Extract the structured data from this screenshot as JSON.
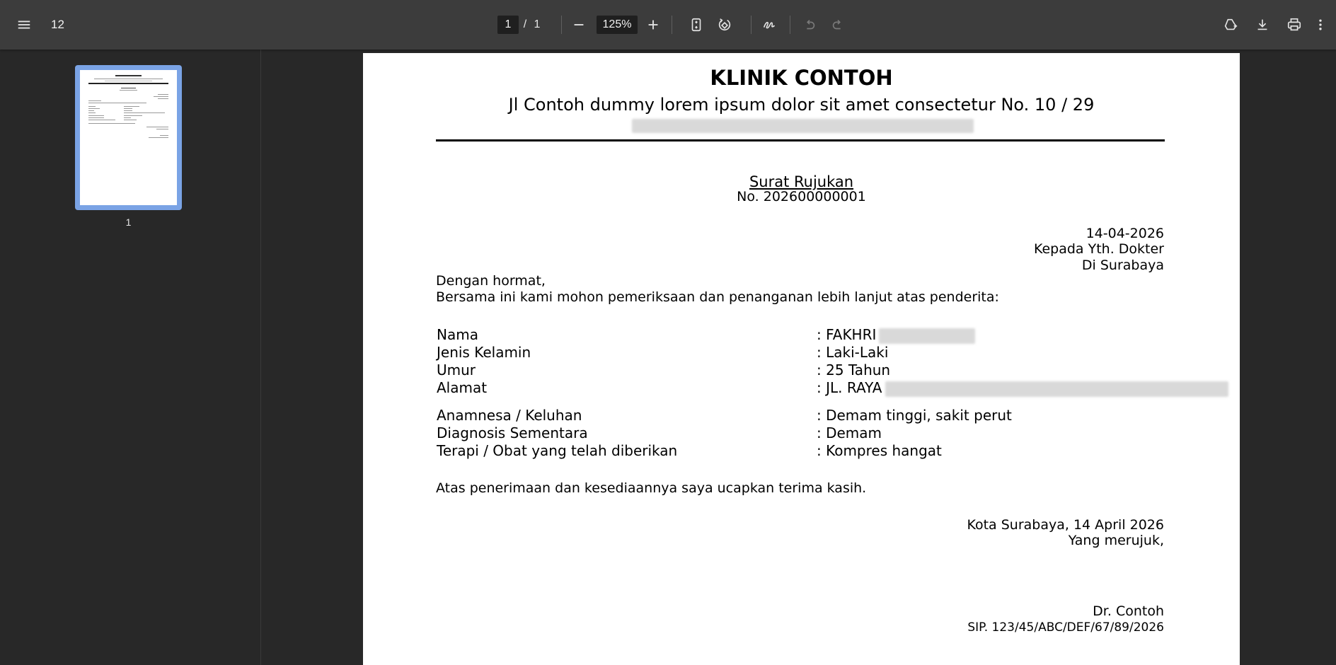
{
  "toolbar": {
    "doc_title": "12",
    "page_current": "1",
    "page_sep": "/",
    "page_total": "1",
    "zoom": "125%",
    "icons": [
      "menu-icon",
      "zoom-out-icon",
      "zoom-in-icon",
      "fit-page-icon",
      "rotate-icon",
      "annotate-icon",
      "undo-icon",
      "redo-icon",
      "save-to-drive-icon",
      "download-icon",
      "print-icon",
      "more-icon"
    ]
  },
  "sidebar": {
    "thumbnail_label": "1"
  },
  "document": {
    "clinic_name": "KLINIK CONTOH",
    "clinic_address": "Jl Contoh dummy lorem ipsum dolor sit amet consectetur No. 10 / 29",
    "letter_title": "Surat Rujukan",
    "letter_number": "No. 202600000001",
    "date": "14-04-2026",
    "recipient_line1": "Kepada Yth. Dokter",
    "recipient_line2": "Di Surabaya",
    "greeting": "Dengan hormat,",
    "intro": "Bersama ini kami mohon pemeriksaan dan penanganan lebih lanjut atas penderita:",
    "patient_fields": [
      {
        "label": "Nama",
        "value": ": FAKHRI"
      },
      {
        "label": "Jenis Kelamin",
        "value": ": Laki-Laki"
      },
      {
        "label": "Umur",
        "value": ": 25 Tahun"
      },
      {
        "label": "Alamat",
        "value": ": JL. RAYA"
      }
    ],
    "clinical_fields": [
      {
        "label": "Anamnesa / Keluhan",
        "value": ": Demam tinggi, sakit perut"
      },
      {
        "label": "Diagnosis Sementara",
        "value": ": Demam"
      },
      {
        "label": "Terapi / Obat yang telah diberikan",
        "value": ": Kompres hangat"
      }
    ],
    "closing": "Atas penerimaan dan kesediaannya saya ucapkan terima kasih.",
    "place_date": "Kota Surabaya, 14 April 2026",
    "referrer_label": "Yang merujuk,",
    "doctor_name": "Dr. Contoh",
    "doctor_sip": "SIP. 123/45/ABC/DEF/67/89/2026"
  },
  "colors": {
    "toolbar_bg": "#3c3c3c",
    "viewer_bg": "#282828",
    "thumb_highlight": "#7aa3e5"
  }
}
